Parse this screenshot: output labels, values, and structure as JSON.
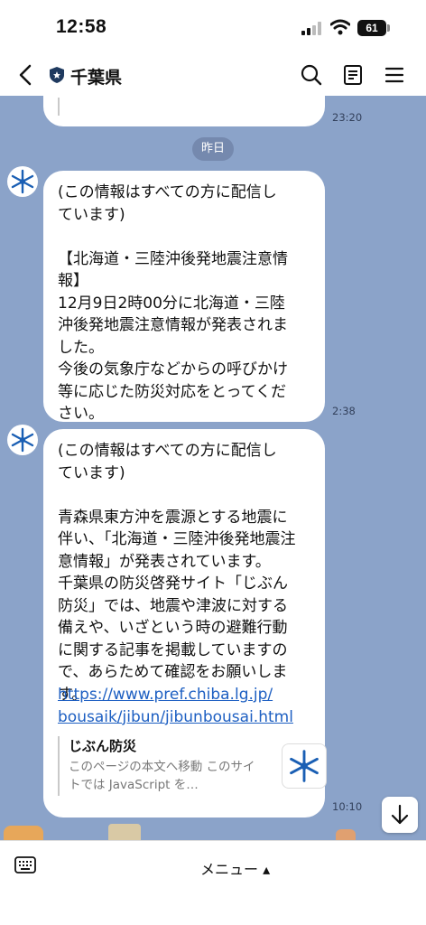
{
  "status": {
    "time": "12:58",
    "battery": "61"
  },
  "header": {
    "title": "千葉県"
  },
  "chat": {
    "top_time": "23:20",
    "date_divider": "昨日",
    "messages": [
      {
        "text": "(この情報はすべての方に配信し\nています)\n\n【北海道・三陸沖後発地震注意情\n報】\n12月9日2時00分に北海道・三陸\n沖後発地震注意情報が発表されま\nした。\n今後の気象庁などからの呼びかけ\n等に応じた防災対応をとってくだ\nさい。",
        "time": "2:38"
      },
      {
        "text": "(この情報はすべての方に配信し\nています)\n\n青森県東方沖を震源とする地震に\n伴い、「北海道・三陸沖後発地震注\n意情報」が発表されています。\n千葉県の防災啓発サイト「じぶん\n防災」では、地震や津波に対する\n備えや、いざという時の避難行動\nに関する記事を掲載していますの\nで、あらためて確認をお願いしま\nす。",
        "link_line1": "https://www.pref.chiba.lg.jp/",
        "link_line2": "bousaik/jibun/jibunbousai.html",
        "preview_title": "じぶん防災",
        "preview_desc": "このページの本文へ移動 このサイトでは JavaScript を…",
        "time": "10:10"
      }
    ]
  },
  "bottom": {
    "menu_label": "メニュー ▴"
  },
  "colors": {
    "chat_bg": "#8ba3c9",
    "link": "#1d5fc2",
    "brand_blue": "#1a5fb4"
  }
}
